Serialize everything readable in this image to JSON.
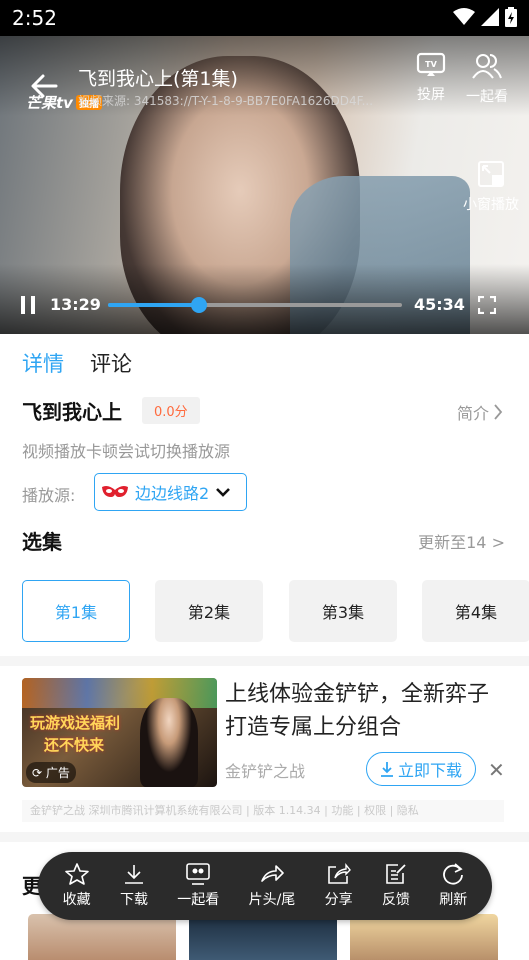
{
  "status_bar": {
    "time": "2:52"
  },
  "player": {
    "title": "飞到我心上(第1集)",
    "subtitle": "视频来源: 341583://T-Y-1-8-9-BB7E0FA1626DD4F...",
    "logo_text": "芒果tv",
    "logo_badge": "独播",
    "cast_label": "投屏",
    "watch_together_label": "一起看",
    "mini_window_label": "小窗播放",
    "current_time": "13:29",
    "total_time": "45:34",
    "progress": 0.31
  },
  "tabs": [
    {
      "label": "详情"
    },
    {
      "label": "评论"
    }
  ],
  "details": {
    "name": "飞到我心上",
    "score": "0.0分",
    "intro_label": "简介",
    "hint": "视频播放卡顿尝试切换播放源",
    "source_label": "播放源:",
    "source_value": "边边线路2"
  },
  "episodes": {
    "title": "选集",
    "update_text": "更新至14",
    "items": [
      "第1集",
      "第2集",
      "第3集",
      "第4集"
    ],
    "selected_index": 0
  },
  "ad": {
    "image_text_1": "玩游戏送福利",
    "image_text_2": "还不快来",
    "tag": "广告",
    "title": "上线体验金铲铲，全新弈子打造专属上分组合",
    "brand": "金铲铲之战",
    "download_label": "立即下载",
    "footer": "金铲铲之战 深圳市腾讯计算机系统有限公司 | 版本 1.14.34 | 功能 | 权限 | 隐私"
  },
  "more": {
    "title": "更多推荐"
  },
  "toolbar": {
    "items": [
      {
        "label": "收藏",
        "icon": "star-icon"
      },
      {
        "label": "下载",
        "icon": "download-icon"
      },
      {
        "label": "一起看",
        "icon": "watch-together-icon"
      },
      {
        "label": "片头/尾",
        "icon": "skip-icon"
      },
      {
        "label": "分享",
        "icon": "share-icon"
      },
      {
        "label": "反馈",
        "icon": "feedback-icon"
      },
      {
        "label": "刷新",
        "icon": "refresh-icon"
      }
    ]
  },
  "colors": {
    "accent": "#2fa5f3",
    "score": "#ff6a3d",
    "toolbar_bg": "#2b2b2b"
  }
}
